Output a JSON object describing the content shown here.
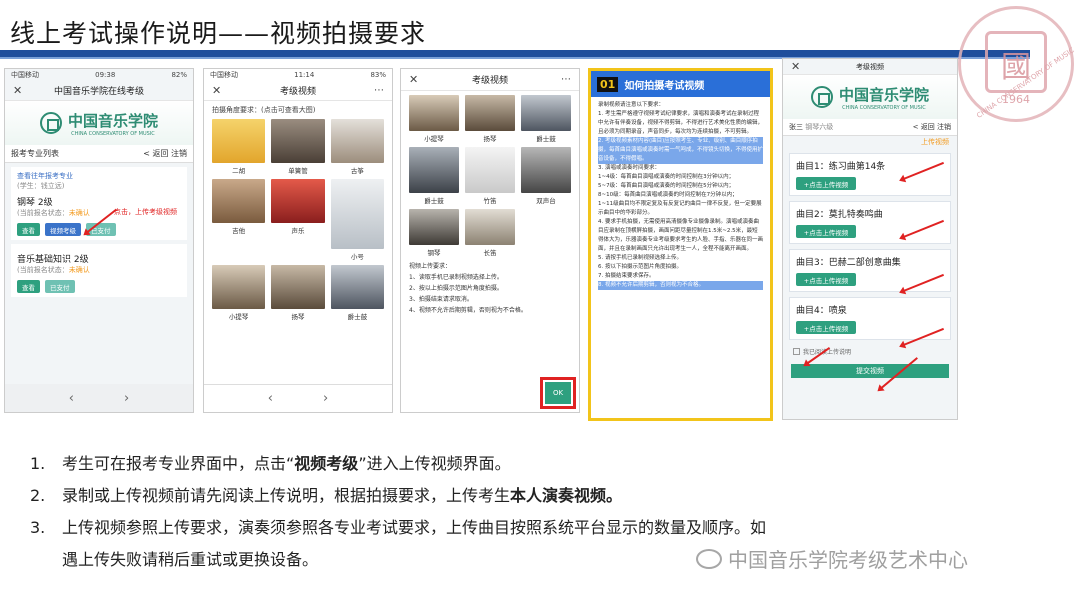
{
  "header": {
    "title": "线上考试操作说明——视频拍摄要求",
    "seal_year": "1964",
    "seal_glyph": "國",
    "seal_text": "CHINA CONSERVATORY OF MUSIC"
  },
  "phone1": {
    "status_left": "中国移动",
    "status_time": "09:38",
    "status_right": "82%",
    "nav_title": "中国音乐学院在线考级",
    "logo_cn": "中国音乐学院",
    "logo_en": "CHINA CONSERVATORY OF MUSIC",
    "list_title": "报考专业列表",
    "back": "< 返回",
    "logout": "注销",
    "view_history": "查看往年报考专业",
    "student_label": "(学生：钱立远)",
    "items": [
      {
        "name": "钢琴 2级",
        "status_label": "(当前报名状态：",
        "status_value": "未确认",
        "b1": "查看",
        "b2": "视频考级",
        "b3": "已支付"
      },
      {
        "name": "音乐基础知识 2级",
        "status_label": "(当前报名状态：",
        "status_value": "未确认",
        "b1": "查看",
        "b3": "已支付"
      }
    ],
    "red_note": "点击，上传考级视频"
  },
  "phone2": {
    "status_left": "中国移动",
    "status_time": "11:14",
    "status_right": "83%",
    "nav_title": "考级视频",
    "req": "拍摄角度要求：(点击可查看大图)",
    "thumbs": [
      "二胡",
      "单簧管",
      "古筝",
      "吉他",
      "声乐",
      "小号",
      "小提琴",
      "扬琴",
      "爵士鼓"
    ]
  },
  "phone3": {
    "nav_title": "考级视频",
    "thumbs": [
      "小提琴",
      "扬琴",
      "爵士鼓",
      "爵士鼓",
      "竹笛",
      "双声台",
      "钢琴",
      "长笛"
    ],
    "req_title": "视频上传要求：",
    "req_items": [
      "1、读取手机已录制视频选择上传。",
      "2、按以上拍摄示范图片角度拍摄。",
      "3、拍摄结束请求取消。",
      "4、视频不允许后期剪辑，否则视为不合格。"
    ],
    "ok": "OK"
  },
  "guide": {
    "num": "01",
    "title": "如何拍摄考试视频",
    "intro": "录制视频请注意以下要求：",
    "p1": "1. 考生需严格遵守视频考试纪律要求，演唱和演奏考试在录制过程中允许有伴奏设备，视频不得剪辑，不得进行艺术美化性质的编辑，且必须为同期录音，声音同步，每次均为连续拍摄，不可剪辑。",
    "p2": "2. 考级视频素材内容(曲目)应按照考生、专业、级别、曲目顺序拍摄，每首曲目演唱或演奏时需一气呵成，不得镜头切换，不得使用扩音设备，不得假唱。",
    "p3": "3. 演唱或演奏时间要求：",
    "p3a": "1~4级：每首曲目演唱或演奏的时间控制在3分钟以内；",
    "p3b": "5~7级：每首曲目演唱或演奏的时间控制在5分钟以内；",
    "p3c": "8~10级：每首曲目演唱或演奏的时间控制在7分钟以内；",
    "p3d": "1~11级曲目均不限定复及有反复记的曲目一律不反复，但一定要展示曲目中的华彩部分。",
    "p4": "4. 要求手机拍摄，无需使用高清摄像专业摄像录制。演唱或演奏曲目应录制在顶横屏拍摄，画面问距尽量控制在1.5米~2.5米，最短得体大为，乐器演奏专业考级要求考生的人脸、手指、乐器在同一画面，并且在录制画面只允许出现考生一人，全程不能离开画面。",
    "p5": "5. 请按手机已录制视频选择上传。",
    "p6": "6. 按以下拍摄示范图片角度拍摄。",
    "p7": "7. 拍摄结束要求保存。",
    "p8": "8. 视频不允许后期剪辑，否则视为不合格。"
  },
  "phone5": {
    "nav_title": "考级视频",
    "logo_cn": "中国音乐学院",
    "logo_en": "CHINA CONSERVATORY OF MUSIC",
    "name": "张三",
    "level": "钢琴六级",
    "back": "< 返回",
    "logout": "注销",
    "status": "上传视频",
    "songs": [
      {
        "label": "曲目1：练习曲第14条",
        "btn": "+点击上传视频"
      },
      {
        "label": "曲目2：莫扎特奏鸣曲",
        "btn": "+点击上传视频"
      },
      {
        "label": "曲目3：巴赫二部创意曲集",
        "btn": "+点击上传视频"
      },
      {
        "label": "曲目4：喷泉",
        "btn": "+点击上传视频"
      }
    ],
    "agree": "我已阅读上传说明",
    "submit": "提交视频"
  },
  "steps": [
    {
      "n": "1.",
      "pre": "考生可在报考专业界面中，点击“",
      "bold": "视频考级",
      "post": "”进入上传视频界面。"
    },
    {
      "n": "2.",
      "pre": "录制或上传视频前请先阅读上传说明，根据拍摄要求，上传考生",
      "bold": "本人演奏视频。",
      "post": ""
    },
    {
      "n": "3.",
      "pre": "上传视频参照上传要求，演奏须参照各专业考试要求，上传曲目按照系统平台显示的数量及顺序。如",
      "bold": "",
      "post": ""
    }
  ],
  "step3_cont": "遇上传失败请稍后重试或更换设备。",
  "watermark": "中国音乐学院考级艺术中心",
  "colors": {
    "accent_green": "#2ea07f",
    "title_bar": "#1f4e9c",
    "alert_red": "#e02222",
    "guide_blue": "#2a6fd8"
  }
}
